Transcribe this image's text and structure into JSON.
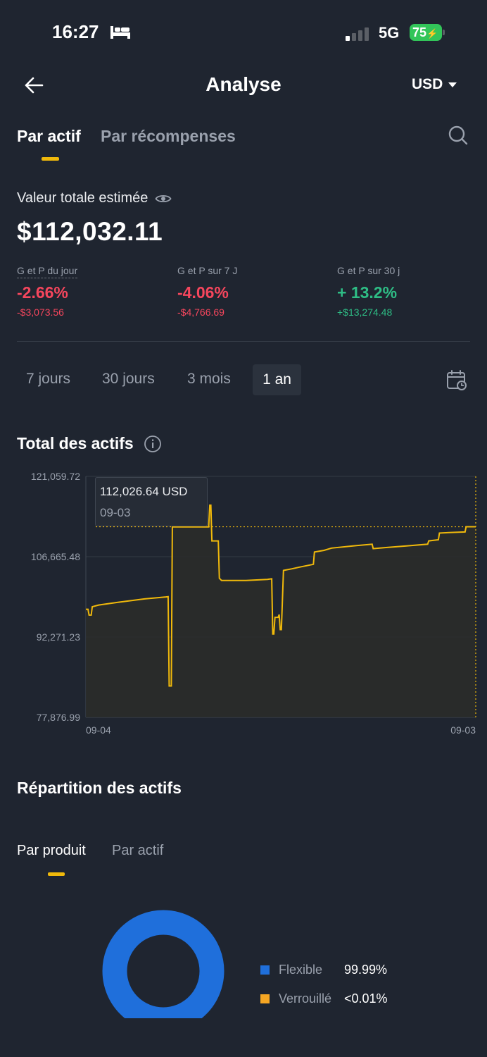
{
  "status_bar": {
    "time": "16:27",
    "network": "5G",
    "battery": "75"
  },
  "header": {
    "title": "Analyse",
    "currency": "USD"
  },
  "tabs": {
    "active": "Par actif",
    "inactive": "Par récompenses"
  },
  "summary": {
    "label": "Valeur totale estimée",
    "total": "$112,032.11",
    "pnl": [
      {
        "label": "G et P du jour",
        "pct": "-2.66%",
        "amount": "-$3,073.56",
        "trend": "down"
      },
      {
        "label": "G et P sur 7 J",
        "pct": "-4.06%",
        "amount": "-$4,766.69",
        "trend": "down"
      },
      {
        "label": "G et P sur 30 j",
        "pct": "+ 13.2%",
        "amount": "+$13,274.48",
        "trend": "up"
      }
    ]
  },
  "ranges": {
    "r7": "7 jours",
    "r30": "30 jours",
    "r3m": "3 mois",
    "r1y": "1 an",
    "selected": "1 an"
  },
  "chart_section": {
    "title": "Total des actifs"
  },
  "tooltip": {
    "value": "112,026.64 USD",
    "date": "09-03"
  },
  "chart_data": {
    "type": "line",
    "title": "Total des actifs",
    "y_ticks": [
      "121,059.72",
      "106,665.48",
      "92,271.23",
      "77,876.99"
    ],
    "x_ticks": [
      "09-04",
      "09-03"
    ],
    "ylim": [
      77876.99,
      121059.72
    ],
    "x_range": [
      0,
      365
    ],
    "grid": true,
    "color": "#f0b90b",
    "highlight": {
      "x": 365,
      "y": 112026.64
    },
    "series": [
      {
        "values": [
          [
            0,
            97250
          ],
          [
            2,
            97250
          ],
          [
            3,
            96200
          ],
          [
            5,
            96200
          ],
          [
            6,
            97700
          ],
          [
            12,
            98000
          ],
          [
            30,
            98500
          ],
          [
            55,
            99100
          ],
          [
            75,
            99450
          ],
          [
            77,
            99500
          ],
          [
            78,
            83500
          ],
          [
            80,
            83500
          ],
          [
            81,
            112000
          ],
          [
            115,
            112000
          ],
          [
            116,
            115900
          ],
          [
            117,
            115900
          ],
          [
            118,
            109500
          ],
          [
            124,
            109500
          ],
          [
            125,
            102800
          ],
          [
            127,
            102400
          ],
          [
            150,
            102400
          ],
          [
            170,
            102600
          ],
          [
            174,
            102700
          ],
          [
            175,
            92800
          ],
          [
            176,
            92800
          ],
          [
            177,
            95800
          ],
          [
            180,
            95800
          ],
          [
            181,
            96300
          ],
          [
            182,
            93600
          ],
          [
            183,
            93600
          ],
          [
            185,
            104200
          ],
          [
            193,
            104500
          ],
          [
            200,
            104800
          ],
          [
            213,
            105300
          ],
          [
            214,
            107500
          ],
          [
            223,
            107800
          ],
          [
            230,
            108200
          ],
          [
            250,
            108600
          ],
          [
            268,
            108900
          ],
          [
            269,
            108100
          ],
          [
            280,
            108300
          ],
          [
            300,
            108600
          ],
          [
            320,
            108900
          ],
          [
            321,
            109500
          ],
          [
            330,
            109700
          ],
          [
            331,
            110900
          ],
          [
            340,
            111000
          ],
          [
            355,
            111100
          ],
          [
            356,
            112026.64
          ],
          [
            365,
            112026.64
          ]
        ]
      }
    ]
  },
  "distribution": {
    "title": "Répartition des actifs",
    "tab_active": "Par produit",
    "tab_inactive": "Par actif",
    "legend": [
      {
        "name": "Flexible",
        "value": "99.99%",
        "color": "#1f6fdb"
      },
      {
        "name": "Verrouillé",
        "value": "<0.01%",
        "color": "#f5a623"
      }
    ]
  }
}
